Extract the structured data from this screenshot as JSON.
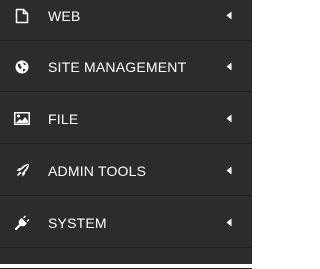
{
  "sidebar": {
    "items": [
      {
        "label": "WEB",
        "icon": "file-icon"
      },
      {
        "label": "SITE MANAGEMENT",
        "icon": "globe-icon"
      },
      {
        "label": "FILE",
        "icon": "image-icon"
      },
      {
        "label": "ADMIN TOOLS",
        "icon": "rocket-icon"
      },
      {
        "label": "SYSTEM",
        "icon": "plug-icon"
      }
    ],
    "caret_icon": "caret-left-icon"
  },
  "colors": {
    "sidebar_bg": "#2c2c2c",
    "text": "#ffffff",
    "divider": "#222222"
  }
}
